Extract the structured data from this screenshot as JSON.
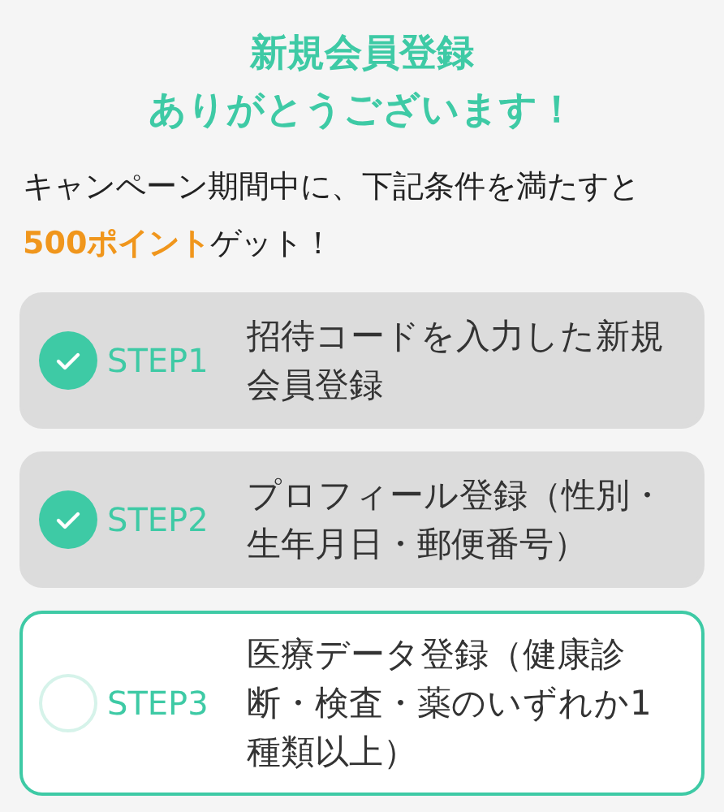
{
  "heading": {
    "lines": [
      "新規会員登録",
      "ありがとうございます！"
    ]
  },
  "intro": "キャンペーン期間中に、下記条件を満たすと**500ポイント**ゲット！",
  "steps": [
    {
      "label": "STEP1",
      "text": "招待コードを入力した新規会員登録",
      "completed": true
    },
    {
      "label": "STEP2",
      "text": "プロフィール登録（性別・生年月日・郵便番号）",
      "completed": true
    },
    {
      "label": "STEP3",
      "text": "医療データ登録（健康診断・検査・薬のいずれか1種類以上）",
      "completed": false
    }
  ]
}
